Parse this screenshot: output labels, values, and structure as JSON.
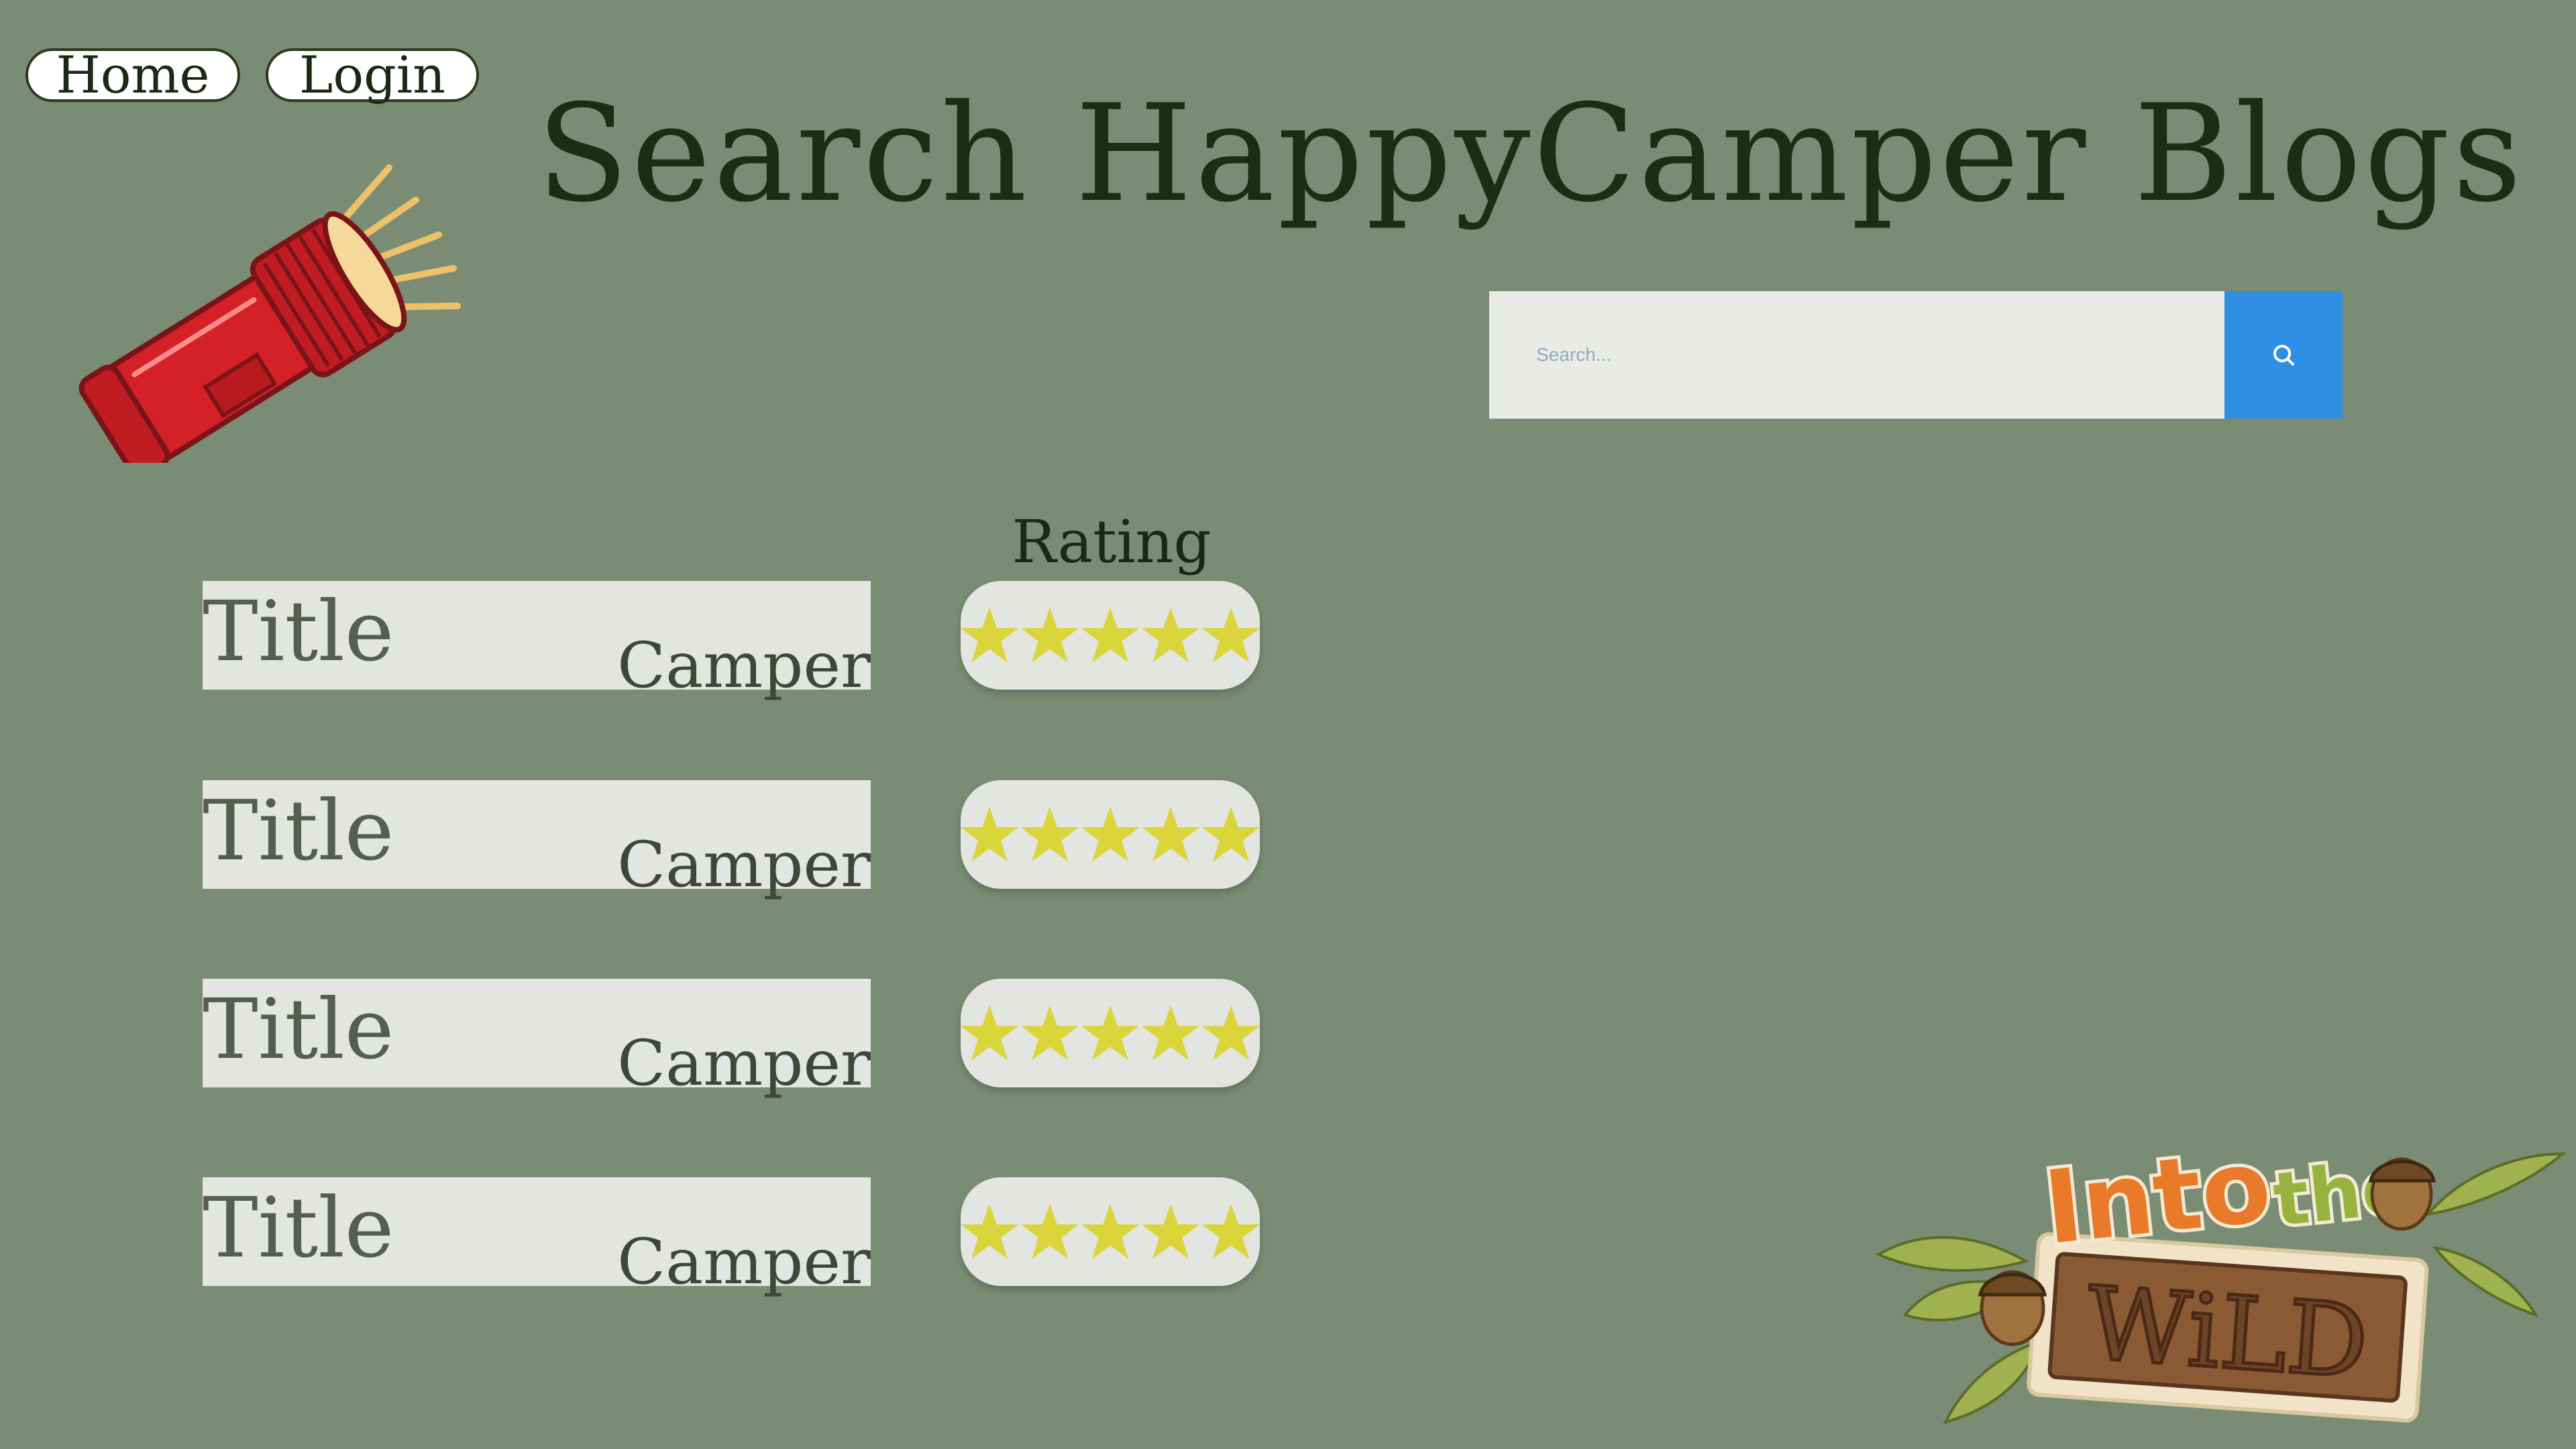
{
  "nav": {
    "home_label": "Home",
    "login_label": "Login"
  },
  "header": {
    "title": "Search HappyCamper Blogs"
  },
  "search": {
    "placeholder": "Search...",
    "value": ""
  },
  "table": {
    "rating_header": "Rating",
    "rows": [
      {
        "title": "Title",
        "author": "Camper",
        "rating": 5
      },
      {
        "title": "Title",
        "author": "Camper",
        "rating": 5
      },
      {
        "title": "Title",
        "author": "Camper",
        "rating": 5
      },
      {
        "title": "Title",
        "author": "Camper",
        "rating": 5
      }
    ]
  },
  "logo": {
    "line1": "Into",
    "line2": "the",
    "line3": "WiLD"
  },
  "icons": {
    "flashlight": "flashlight-icon",
    "search": "search-icon",
    "star": "star-icon"
  },
  "colors": {
    "background": "#7a8c73",
    "search_button": "#2f8fe5",
    "star": "#dad53a",
    "title_text": "#1a2e13"
  }
}
